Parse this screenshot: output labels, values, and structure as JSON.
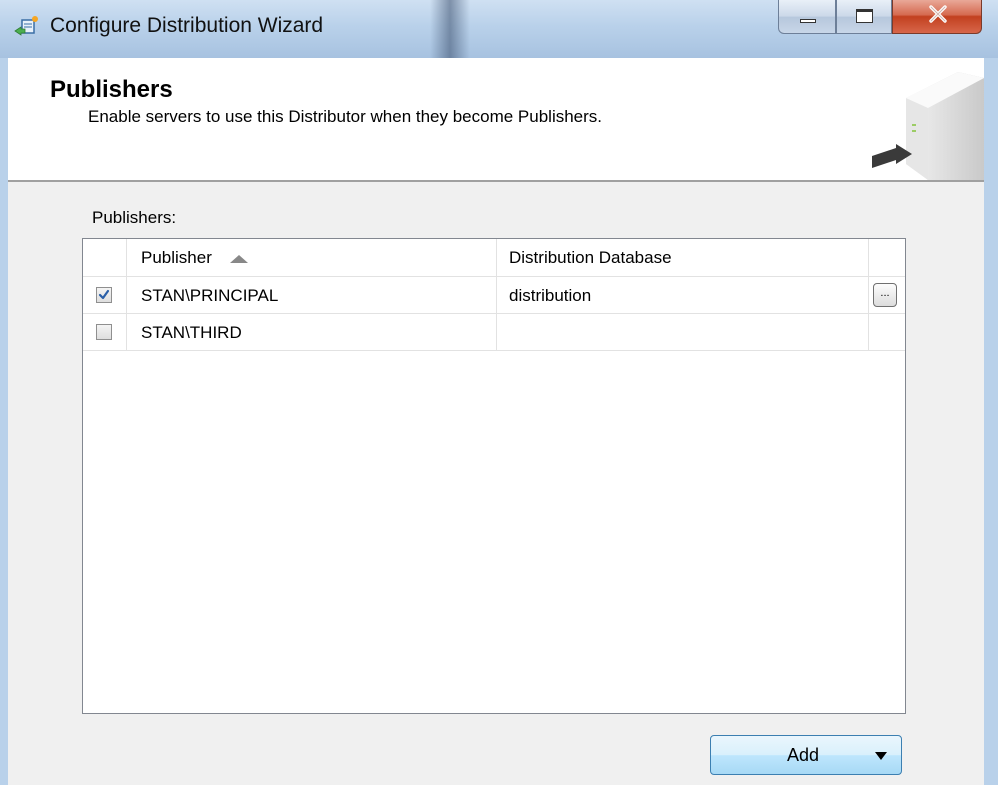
{
  "window": {
    "title": "Configure Distribution Wizard",
    "controls": {
      "minimize": "minimize-icon",
      "maximize": "maximize-icon",
      "close": "close-icon"
    }
  },
  "header": {
    "title": "Publishers",
    "subtitle": "Enable servers to use this Distributor when they become Publishers."
  },
  "publishers_list": {
    "label": "Publishers:",
    "columns": [
      "Publisher",
      "Distribution Database"
    ],
    "sort": {
      "column": "Publisher",
      "direction": "ascending"
    },
    "rows": [
      {
        "checked": true,
        "publisher": "STAN\\PRINCIPAL",
        "database": "distribution",
        "button": "..."
      },
      {
        "checked": false,
        "publisher": "STAN\\THIRD",
        "database": ""
      }
    ]
  },
  "footer": {
    "add_label": "Add"
  },
  "colors": {
    "title_bar": "#b9d1ea",
    "close_button": "#c2401f",
    "add_button_border": "#3c7fb1",
    "check_mark": "#2a5fa8"
  }
}
